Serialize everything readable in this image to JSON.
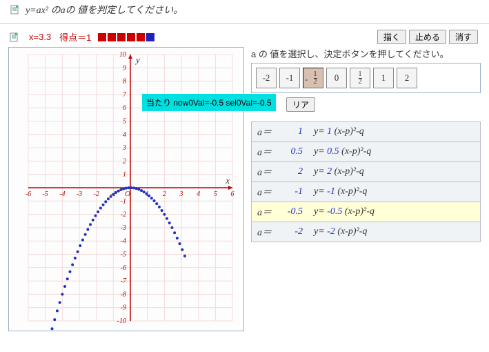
{
  "question": {
    "formula_html": "y=ax²",
    "tail": " のaの 値を判定してください。"
  },
  "status": {
    "x_label": "x=3.3",
    "score_label": "得点＝1",
    "squares": [
      "red",
      "red",
      "red",
      "red",
      "red",
      "blue"
    ]
  },
  "buttons": {
    "draw": "描く",
    "stop": "止める",
    "erase": "消す",
    "clear": "リア"
  },
  "instruction": "a の 値を選択し、決定ボタンを押してください。",
  "choices": [
    {
      "label": "-2",
      "frac": false,
      "pressed": false
    },
    {
      "label": "-1",
      "frac": false,
      "pressed": false
    },
    {
      "label": "1/2",
      "frac": true,
      "top": "1",
      "bot": "2",
      "neg": true,
      "pressed": true
    },
    {
      "label": "0",
      "frac": false,
      "pressed": false
    },
    {
      "label": "1/2",
      "frac": true,
      "top": "1",
      "bot": "2",
      "neg": false,
      "pressed": false
    },
    {
      "label": "1",
      "frac": false,
      "pressed": false
    },
    {
      "label": "2",
      "frac": false,
      "pressed": false
    }
  ],
  "tooltip": "当たり now0Val=-0.5 sel0Val=-0.5",
  "results": [
    {
      "a_lbl": "a＝",
      "val": "1",
      "eq_pre": "y= ",
      "coef": "1",
      "eq_post": " (x-p)²-q",
      "hl": false
    },
    {
      "a_lbl": "a＝",
      "val": "0.5",
      "eq_pre": "y= ",
      "coef": "0.5",
      "eq_post": " (x-p)²-q",
      "hl": false
    },
    {
      "a_lbl": "a＝",
      "val": "2",
      "eq_pre": "y= ",
      "coef": "2",
      "eq_post": " (x-p)²-q",
      "hl": false
    },
    {
      "a_lbl": "a＝",
      "val": "-1",
      "eq_pre": "y= ",
      "coef": "-1",
      "eq_post": " (x-p)²-q",
      "hl": false
    },
    {
      "a_lbl": "a＝",
      "val": "-0.5",
      "eq_pre": "y= ",
      "coef": "-0.5",
      "eq_post": " (x-p)²-q",
      "hl": true
    },
    {
      "a_lbl": "a＝",
      "val": "-2",
      "eq_pre": "y= ",
      "coef": "-2",
      "eq_post": " (x-p)²-q",
      "hl": false
    }
  ],
  "chart_data": {
    "type": "scatter",
    "title": "",
    "xlabel": "x",
    "ylabel": "y",
    "xlim": [
      -6,
      6
    ],
    "ylim": [
      -10,
      10
    ],
    "xticks": [
      -6,
      -5,
      -4,
      -3,
      -2,
      -1,
      0,
      1,
      2,
      3,
      4,
      5,
      6
    ],
    "yticks": [
      -10,
      -9,
      -8,
      -7,
      -6,
      -5,
      -4,
      -3,
      -2,
      -1,
      0,
      1,
      2,
      3,
      4,
      5,
      6,
      7,
      8,
      9,
      10
    ],
    "function": "y = -0.5 * x^2",
    "x_samples_min": -4.6,
    "x_samples_max": 3.3,
    "point_color": "#2030c0"
  }
}
